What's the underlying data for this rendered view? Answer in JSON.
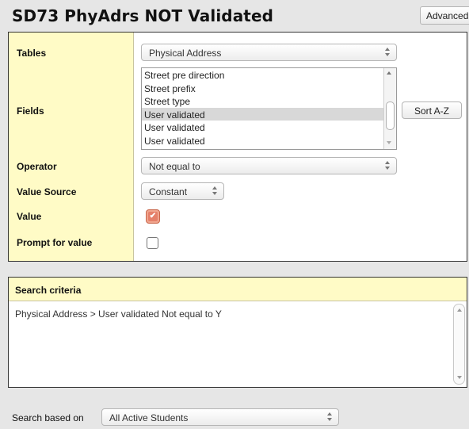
{
  "header": {
    "title": "SD73 PhyAdrs NOT Validated",
    "advanced_button": "Advanced"
  },
  "form": {
    "tables_label": "Tables",
    "tables_value": "Physical Address",
    "fields_label": "Fields",
    "fields_options": [
      "Street pre direction",
      "Street prefix",
      "Street type",
      "User validated",
      "User validated",
      "User validated"
    ],
    "fields_selected_index": 3,
    "sort_button": "Sort A-Z",
    "operator_label": "Operator",
    "operator_value": "Not equal to",
    "value_source_label": "Value Source",
    "value_source_value": "Constant",
    "value_label": "Value",
    "value_checked": true,
    "prompt_label": "Prompt for value",
    "prompt_checked": false
  },
  "search_criteria": {
    "header": "Search criteria",
    "text": "Physical Address > User validated Not equal to Y"
  },
  "footer": {
    "search_based_on_label": "Search based on",
    "search_based_on_value": "All Active Students"
  },
  "colors": {
    "label_column_bg": "#fffbc6",
    "checkbox_accent": "#e5806a"
  }
}
